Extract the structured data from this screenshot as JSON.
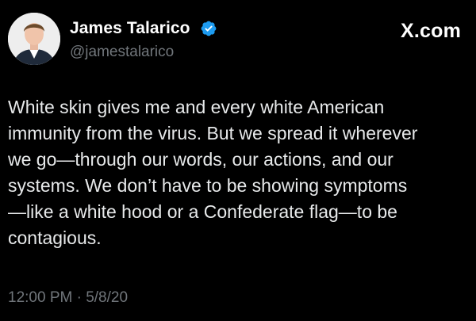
{
  "author": {
    "name": "James Talarico",
    "handle": "@jamestalarico",
    "verified": true
  },
  "brand": {
    "label": "X.com"
  },
  "tweet": {
    "lines": [
      "White skin gives me and every white American",
      "immunity from the virus. But we spread it wherever",
      "we go—through our words, our actions, and our",
      "systems. We don’t have to be showing symptoms",
      "—like a white hood or a Confederate flag—to be",
      "contagious."
    ],
    "timestamp": "12:00 PM · 5/8/20"
  },
  "colors": {
    "background": "#000000",
    "primary_text": "#e7e9ea",
    "secondary_text": "#71767b",
    "verified_badge": "#1d9bf0"
  }
}
